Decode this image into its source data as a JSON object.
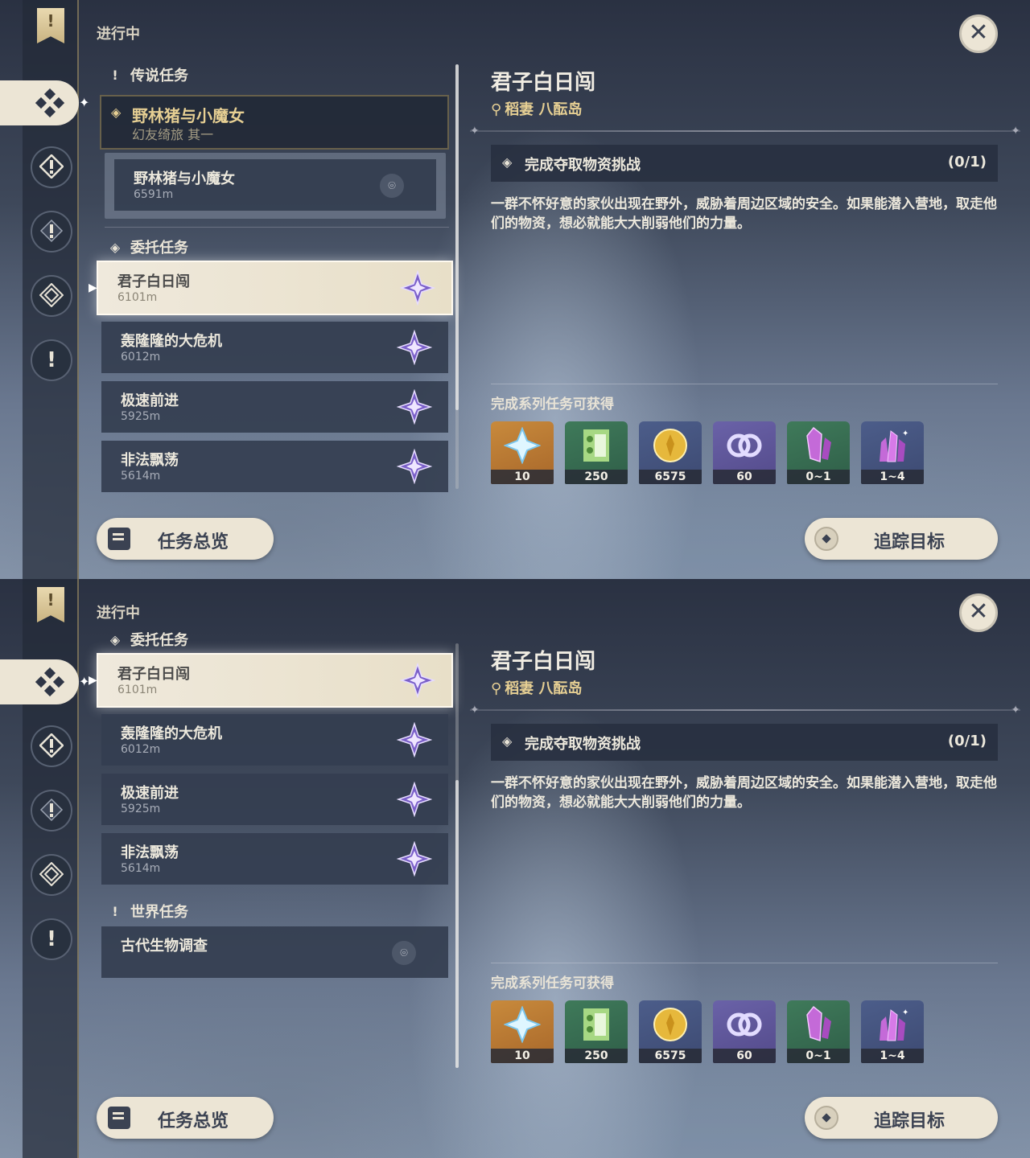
{
  "close_symbol": "✕",
  "rail_alert": "!",
  "in_progress": "进行中",
  "screens": [
    {
      "sections": [
        {
          "icon": "alert-icon",
          "title": "传说任务"
        },
        {
          "icon": "commission-icon",
          "title": "委托任务"
        }
      ],
      "legend_card": {
        "name": "野林猪与小魔女",
        "subtitle": "幻友绮旅 其一"
      },
      "legend_sub": {
        "name": "野林猪与小魔女",
        "distance": "6591m"
      },
      "quests": [
        {
          "name": "君子白日闯",
          "distance": "6101m",
          "selected": true
        },
        {
          "name": "轰隆隆的大危机",
          "distance": "6012m"
        },
        {
          "name": "极速前进",
          "distance": "5925m"
        },
        {
          "name": "非法飘荡",
          "distance": "5614m"
        }
      ]
    },
    {
      "sections": [
        {
          "icon": "commission-icon",
          "title": "委托任务"
        },
        {
          "icon": "alert-icon",
          "title": "世界任务"
        }
      ],
      "quests": [
        {
          "name": "君子白日闯",
          "distance": "6101m",
          "selected": true
        },
        {
          "name": "轰隆隆的大危机",
          "distance": "6012m"
        },
        {
          "name": "极速前进",
          "distance": "5925m"
        },
        {
          "name": "非法飘荡",
          "distance": "5614m"
        }
      ],
      "world_quest": {
        "name": "古代生物调查"
      }
    }
  ],
  "detail": {
    "title": "君子白日闯",
    "location": "稻妻 八酝岛",
    "objective": "完成夺取物资挑战",
    "objective_count": "(0/1)",
    "description": "一群不怀好意的家伙出现在野外，威胁着周边区域的安全。如果能潜入营地，取走他们的物资，想必就能大大削弱他们的力量。",
    "rewards_heading": "完成系列任务可获得",
    "rewards": [
      {
        "icon": "primogem-icon",
        "count": "10",
        "color": "#c88a3c"
      },
      {
        "icon": "adventure-exp-icon",
        "count": "250",
        "color": "#3f7a5a"
      },
      {
        "icon": "mora-icon",
        "count": "6575",
        "color": "#4c5d8a"
      },
      {
        "icon": "companionship-exp-icon",
        "count": "60",
        "color": "#6a62a8"
      },
      {
        "icon": "purple-crystal-icon",
        "count": "0~1",
        "color": "#3f7a5a"
      },
      {
        "icon": "purple-crystal-cluster-icon",
        "count": "1~4",
        "color": "#4c5d8a"
      }
    ]
  },
  "buttons": {
    "overview": "任务总览",
    "track": "追踪目标"
  }
}
